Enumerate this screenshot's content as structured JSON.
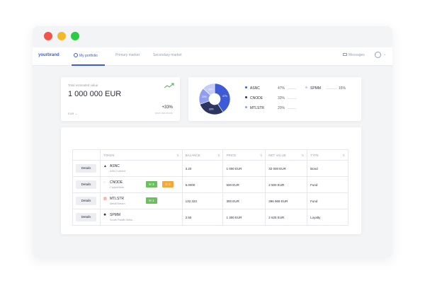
{
  "nav": {
    "brand": "yourbrand",
    "tabs": [
      {
        "label": "My portfolio",
        "active": true
      },
      {
        "label": "Primary market",
        "active": false
      },
      {
        "label": "Secondary market",
        "active": false
      }
    ],
    "messages_label": "Messages"
  },
  "value_card": {
    "label": "Total estimated value",
    "amount": "1 000 000 EUR",
    "change": "+33%",
    "currency_select": "EUR",
    "period": "since last month"
  },
  "chart_data": {
    "type": "pie",
    "categories": [
      "ASNC",
      "CNODE",
      "MTLSTR",
      "SPMM"
    ],
    "values": [
      47,
      33,
      20,
      15
    ],
    "labels": [
      "47%",
      "33%",
      "20%",
      "15%"
    ],
    "colors": [
      "#3d5bd6",
      "#2c3561",
      "#8f9ef0",
      "#c4cbf6"
    ]
  },
  "table": {
    "headers": [
      "TOKEN",
      "BALANCE",
      "PRICE",
      "NET VALUE",
      "TYPE"
    ],
    "details_label": "Details",
    "rows": [
      {
        "token": "ASNC",
        "sub": "ASN Coinent",
        "balance": "3.20",
        "price": "1 000 EUR",
        "net_value": "32 000 EUR",
        "type": "Bond",
        "badges": []
      },
      {
        "token": "CNODE",
        "sub": "CryptoNode",
        "balance": "5.0000",
        "price": "500 EUR",
        "net_value": "2 500 EUR",
        "type": "Fund",
        "badges": [
          {
            "label": "3",
            "color": "green"
          },
          {
            "label": "3",
            "color": "orange"
          }
        ]
      },
      {
        "token": "MTLSTR",
        "sub": "MetalStream",
        "balance": "132.323",
        "price": "300 EUR",
        "net_value": "396 969 EUR",
        "type": "Fund",
        "badges": [
          {
            "label": "1",
            "color": "green"
          }
        ]
      },
      {
        "token": "SPMM",
        "sub": "South Pacific Meta...",
        "balance": "2.50",
        "price": "1 300 EUR",
        "net_value": "2 625 EUR",
        "type": "Loyalty",
        "badges": []
      }
    ]
  }
}
